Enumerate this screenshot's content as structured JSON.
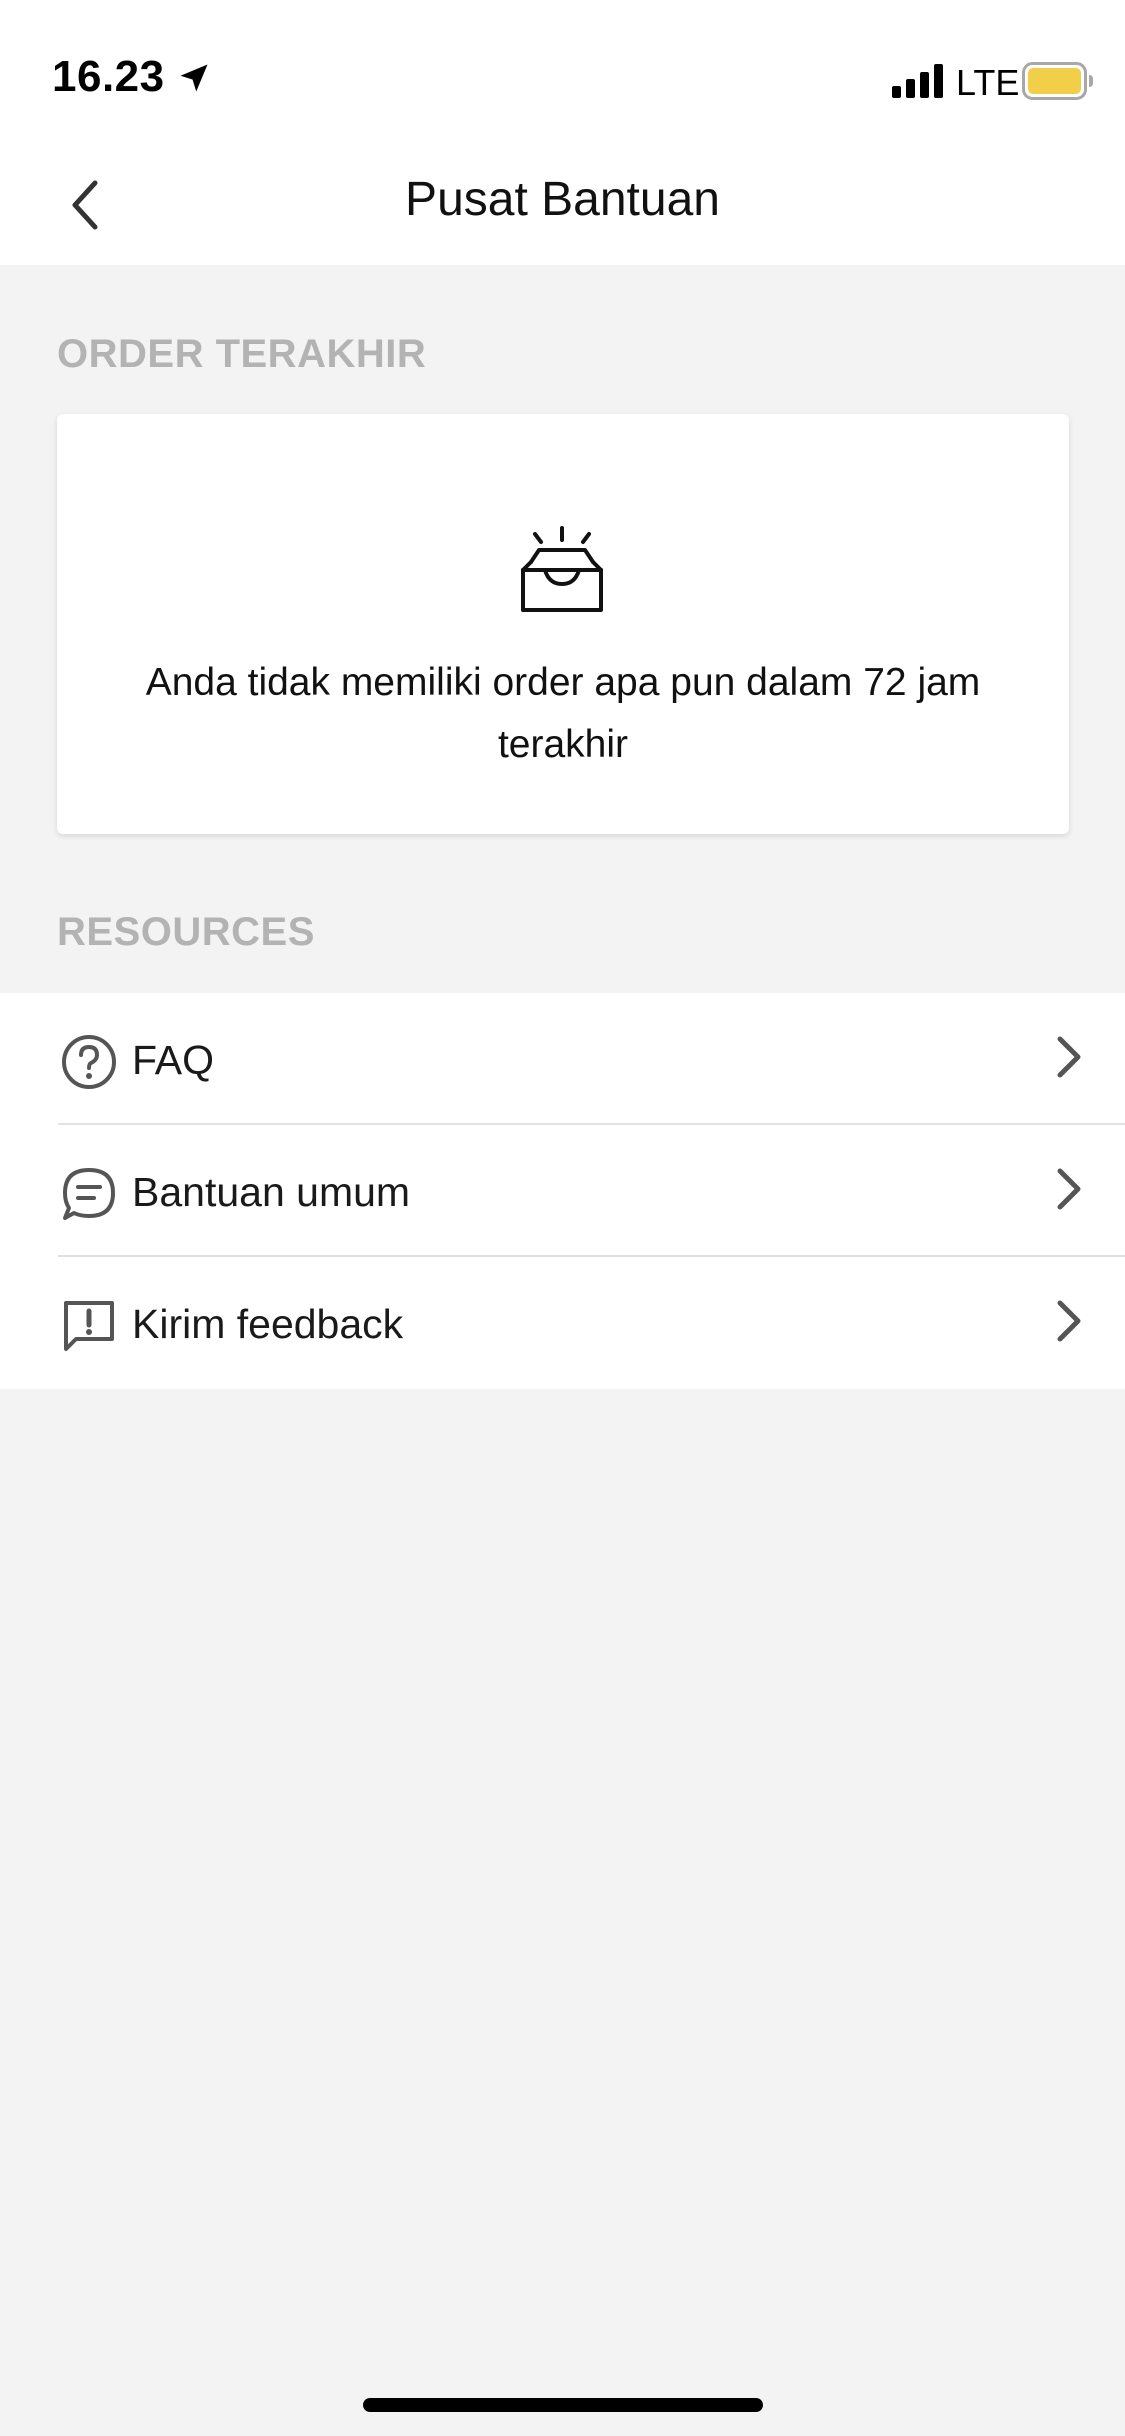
{
  "status_bar": {
    "time": "16.23",
    "network": "LTE",
    "battery_color": "#f2cf49"
  },
  "header": {
    "title": "Pusat Bantuan",
    "back_icon": "chevron-left-icon"
  },
  "recent_orders": {
    "section_title": "ORDER TERAKHIR",
    "empty_icon": "inbox-icon",
    "empty_message": "Anda tidak memiliki order apa pun dalam 72 jam terakhir"
  },
  "resources": {
    "section_title": "RESOURCES",
    "items": [
      {
        "label": "FAQ",
        "icon": "question-circle-icon"
      },
      {
        "label": "Bantuan umum",
        "icon": "chat-bubble-icon"
      },
      {
        "label": "Kirim feedback",
        "icon": "feedback-alert-icon"
      }
    ]
  },
  "colors": {
    "background": "#f3f3f3",
    "surface": "#ffffff",
    "section_header": "#b3b3b3",
    "text_primary": "#1a1a1a",
    "icon": "#555555"
  }
}
